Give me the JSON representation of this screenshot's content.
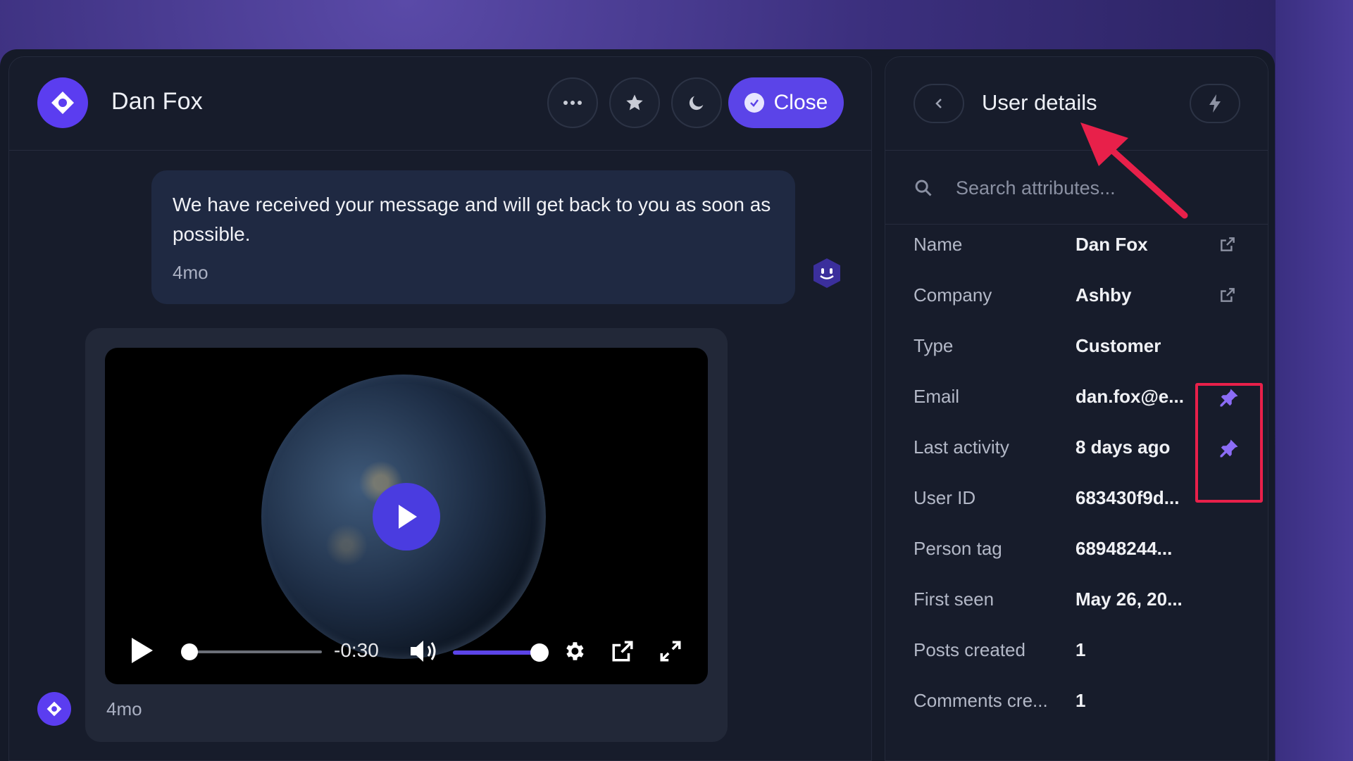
{
  "conversation": {
    "title": "Dan Fox",
    "header_buttons": [
      "more-options",
      "star",
      "snooze"
    ],
    "close_label": "Close",
    "message": {
      "text": "We have received your message and will get back to you as soon as possible.",
      "time": "4mo"
    },
    "video": {
      "remaining": "-0:30",
      "progress": 0,
      "volume": 1.0,
      "time": "4mo"
    }
  },
  "details": {
    "title": "User details",
    "search_placeholder": "Search attributes...",
    "attributes": [
      {
        "label": "Name",
        "value": "Dan Fox",
        "icon": "external-link-icon"
      },
      {
        "label": "Company",
        "value": "Ashby",
        "icon": "external-link-icon"
      },
      {
        "label": "Type",
        "value": "Customer",
        "icon": ""
      },
      {
        "label": "Email",
        "value": "dan.fox@e...",
        "icon": "pin-icon"
      },
      {
        "label": "Last activity",
        "value": "8 days ago",
        "icon": "pin-icon"
      },
      {
        "label": "User ID",
        "value": "683430f9d...",
        "icon": ""
      },
      {
        "label": "Person tag",
        "value": "68948244...",
        "icon": ""
      },
      {
        "label": "First seen",
        "value": "May 26, 20...",
        "icon": ""
      },
      {
        "label": "Posts created",
        "value": "1",
        "icon": ""
      },
      {
        "label": "Comments cre...",
        "value": "1",
        "icon": ""
      }
    ]
  },
  "colors": {
    "accent": "#5b44e8",
    "panel": "#171c2b",
    "annotation": "#e8204a",
    "pin": "#8b6cf6"
  }
}
